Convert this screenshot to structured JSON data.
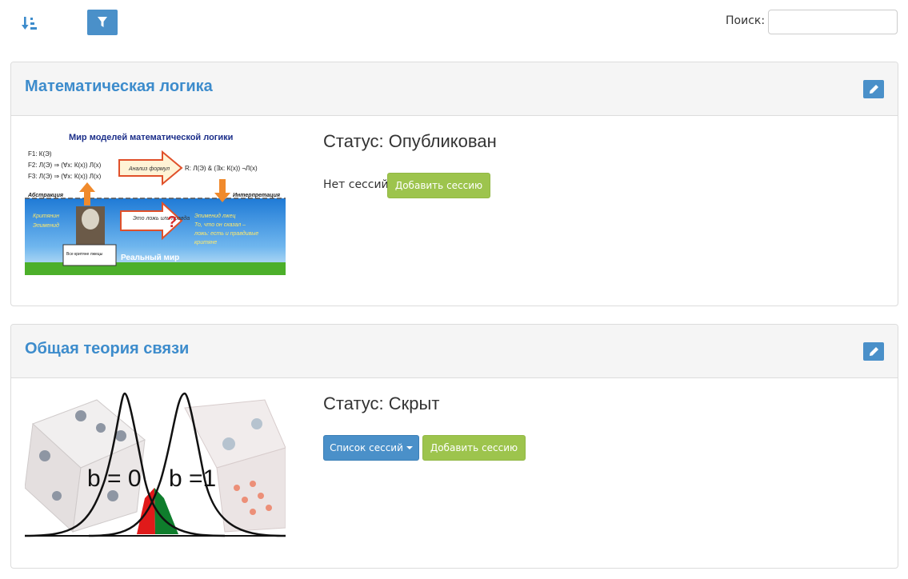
{
  "toolbar": {
    "sort_icon": "sort-amount-desc-icon",
    "filter_icon": "filter-icon",
    "search_label": "Поиск:",
    "search_value": "",
    "search_placeholder": ""
  },
  "colors": {
    "accent_blue": "#4a90c9",
    "title_blue": "#3d8ccc",
    "green_button": "#9dc44d"
  },
  "courses": [
    {
      "title": "Математическая логика",
      "status": "Статус: Опубликован",
      "no_sessions_text": "Нет сессий",
      "add_session_label": "Добавить сессию",
      "image": {
        "heading": "Мир моделей математической логики",
        "lines": [
          "F1: К(Э)",
          "F2: Л(Э) ⇒ (∀x: К(x)) Л(x)",
          "F3: Л(Э) ⇒ (∀x: К(x)) Л(x)"
        ],
        "arrow_label": "Анализ формул",
        "result": "R: Л(Э) & (∃x: К(x)) ¬Л(x)",
        "abstraction": "Абстракция",
        "interpretation": "Интерпретация",
        "left_names": [
          "Критянин",
          "Эпименид"
        ],
        "sign": "Все критяне лжецы",
        "question": "Это ложь или правда",
        "right_text": [
          "Эпименид лжец",
          "То, что он сказал –",
          "ложь: есть и правдивые",
          "критяне"
        ],
        "real_world": "Реальный мир"
      }
    },
    {
      "title": "Общая теория связи",
      "status": "Статус: Скрыт",
      "session_list_label": "Список сессий",
      "add_session_label": "Добавить сессию",
      "image": {
        "label_left": "b = 0",
        "label_right": "b =1"
      }
    }
  ]
}
